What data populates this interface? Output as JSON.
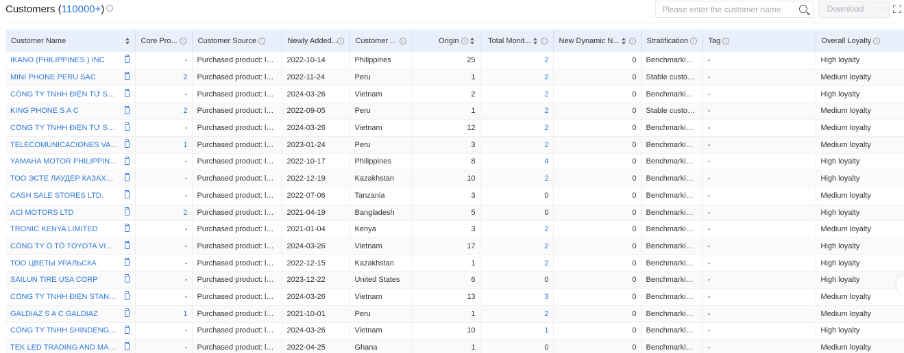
{
  "header": {
    "title": "Customers (",
    "count": "110000+",
    "title_close": ")",
    "search_placeholder": "Please enter the customer name",
    "download_label": "Download",
    "more_label": "···"
  },
  "columns": [
    {
      "label": "Customer Name",
      "info": false,
      "sort": true
    },
    {
      "label": "Core Pro...",
      "info": true,
      "sort": false
    },
    {
      "label": "Customer Source",
      "info": true,
      "sort": false
    },
    {
      "label": "Newly Added...",
      "info": true,
      "sort": false
    },
    {
      "label": "Customer ...",
      "info": true,
      "sort": false
    },
    {
      "label": "Origin",
      "info": true,
      "sort": true
    },
    {
      "label": "Total Monit...",
      "info": true,
      "sort": true
    },
    {
      "label": "New Dynamic N...",
      "info": true,
      "sort": true
    },
    {
      "label": "Stratification",
      "info": true,
      "sort": false
    },
    {
      "label": "Tag",
      "info": true,
      "sort": false
    },
    {
      "label": "Overall Loyalty",
      "info": true,
      "sort": false
    }
  ],
  "rows": [
    {
      "name": "IKANO (PHILIPPINES ) INC",
      "core": "-",
      "source": "Purchased product: led li...",
      "added": "2022-10-14",
      "country": "Philippines",
      "origin": "25",
      "monitored": "2",
      "dynamic": "0",
      "strat": "Benchmarking ...",
      "tag": "-",
      "loyalty": "High loyalty"
    },
    {
      "name": "MINI PHONE PERU SAC",
      "core": "2",
      "source": "Purchased product: led li...",
      "added": "2022-11-24",
      "country": "Peru",
      "origin": "1",
      "monitored": "2",
      "dynamic": "0",
      "strat": "Stable custome...",
      "tag": "-",
      "loyalty": "Medium loyalty"
    },
    {
      "name": "CÔNG TY TNHH ĐIỆN TỬ SNC VIỆ...",
      "core": "-",
      "source": "Purchased product: led li...",
      "added": "2024-03-26",
      "country": "Vietnam",
      "origin": "2",
      "monitored": "2",
      "dynamic": "0",
      "strat": "Benchmarking ...",
      "tag": "-",
      "loyalty": "High loyalty"
    },
    {
      "name": "KING PHONE S A C",
      "core": "2",
      "source": "Purchased product: led li...",
      "added": "2022-09-05",
      "country": "Peru",
      "origin": "1",
      "monitored": "2",
      "dynamic": "0",
      "strat": "Stable custome...",
      "tag": "-",
      "loyalty": "Medium loyalty"
    },
    {
      "name": "CÔNG TY TNHH ĐIỆN TỬ SAMSU...",
      "core": "-",
      "source": "Purchased product: led li...",
      "added": "2024-03-26",
      "country": "Vietnam",
      "origin": "12",
      "monitored": "2",
      "dynamic": "0",
      "strat": "Benchmarking ...",
      "tag": "-",
      "loyalty": "Medium loyalty"
    },
    {
      "name": "TELECOMUNICACIONES VALLE S ...",
      "core": "1",
      "source": "Purchased product: led li...",
      "added": "2023-01-24",
      "country": "Peru",
      "origin": "3",
      "monitored": "2",
      "dynamic": "0",
      "strat": "Benchmarking ...",
      "tag": "-",
      "loyalty": "Medium loyalty"
    },
    {
      "name": "YAMAHA MOTOR PHILIPPINES INC.",
      "core": "-",
      "source": "Purchased product: led li...",
      "added": "2022-10-17",
      "country": "Philippines",
      "origin": "8",
      "monitored": "4",
      "dynamic": "0",
      "strat": "Benchmarking ...",
      "tag": "-",
      "loyalty": "High loyalty"
    },
    {
      "name": "ТОО ЭСТЕ ЛАУДЕР КАЗАХСТАН",
      "core": "-",
      "source": "Purchased product: led li...",
      "added": "2022-12-19",
      "country": "Kazakhstan",
      "origin": "10",
      "monitored": "2",
      "dynamic": "0",
      "strat": "Benchmarking ...",
      "tag": "-",
      "loyalty": "High loyalty"
    },
    {
      "name": "CASH SALE STORES LTD.",
      "core": "-",
      "source": "Purchased product: led li...",
      "added": "2022-07-06",
      "country": "Tanzania",
      "origin": "3",
      "monitored": "0",
      "dynamic": "0",
      "strat": "Benchmarking ...",
      "tag": "-",
      "loyalty": "Medium loyalty"
    },
    {
      "name": "ACI MOTORS LTD",
      "core": "2",
      "source": "Purchased product: led li...",
      "added": "2021-04-19",
      "country": "Bangladesh",
      "origin": "5",
      "monitored": "0",
      "dynamic": "0",
      "strat": "Benchmarking ...",
      "tag": "-",
      "loyalty": "High loyalty"
    },
    {
      "name": "TRONIC KENYA LIMITED",
      "core": "-",
      "source": "Purchased product: led li...",
      "added": "2021-01-04",
      "country": "Kenya",
      "origin": "3",
      "monitored": "2",
      "dynamic": "0",
      "strat": "Benchmarking ...",
      "tag": "-",
      "loyalty": "Medium loyalty"
    },
    {
      "name": "CÔNG TY Ô TÔ TOYOTA VIỆT NAM",
      "core": "-",
      "source": "Purchased product: led li...",
      "added": "2024-03-26",
      "country": "Vietnam",
      "origin": "17",
      "monitored": "2",
      "dynamic": "0",
      "strat": "Benchmarking ...",
      "tag": "-",
      "loyalty": "High loyalty"
    },
    {
      "name": "ТОО ЦВЕТЫ УРАЛЬСКА",
      "core": "-",
      "source": "Purchased product: led li...",
      "added": "2022-12-15",
      "country": "Kazakhstan",
      "origin": "1",
      "monitored": "2",
      "dynamic": "0",
      "strat": "Benchmarking ...",
      "tag": "-",
      "loyalty": "High loyalty"
    },
    {
      "name": "SAILUN TIRE USA CORP",
      "core": "-",
      "source": "Purchased product: led li...",
      "added": "2023-12-22",
      "country": "United States",
      "origin": "6",
      "monitored": "0",
      "dynamic": "0",
      "strat": "Benchmarking ...",
      "tag": "-",
      "loyalty": "High loyalty"
    },
    {
      "name": "CÔNG TY TNHH ĐIỆN STANLEY VI...",
      "core": "-",
      "source": "Purchased product: led li...",
      "added": "2024-03-26",
      "country": "Vietnam",
      "origin": "13",
      "monitored": "3",
      "dynamic": "0",
      "strat": "Benchmarking ...",
      "tag": "-",
      "loyalty": "Medium loyalty"
    },
    {
      "name": "GALDIAZ S A C GALDIAZ",
      "core": "1",
      "source": "Purchased product: led li...",
      "added": "2021-10-01",
      "country": "Peru",
      "origin": "1",
      "monitored": "2",
      "dynamic": "0",
      "strat": "Benchmarking ...",
      "tag": "-",
      "loyalty": "Medium loyalty"
    },
    {
      "name": "CÔNG TY TNHH SHINDENGEN VIỆ...",
      "core": "-",
      "source": "Purchased product: led li...",
      "added": "2024-03-26",
      "country": "Vietnam",
      "origin": "10",
      "monitored": "1",
      "dynamic": "0",
      "strat": "Benchmarking ...",
      "tag": "-",
      "loyalty": "High loyalty"
    },
    {
      "name": "TEK LED TRADING AND MANUFAC...",
      "core": "-",
      "source": "Purchased product: led li...",
      "added": "2022-04-25",
      "country": "Ghana",
      "origin": "1",
      "monitored": "0",
      "dynamic": "0",
      "strat": "Benchmarking ...",
      "tag": "-",
      "loyalty": "Medium loyalty"
    }
  ],
  "colors": {
    "accent": "#2f78d8",
    "header_bg": "#e9f0fb"
  }
}
